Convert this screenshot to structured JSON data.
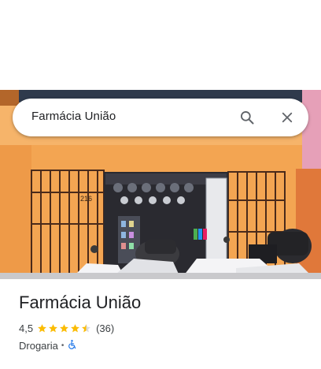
{
  "search": {
    "query": "Farmácia União"
  },
  "photo": {
    "shop_number": "216"
  },
  "place": {
    "title": "Farmácia União",
    "rating": "4,5",
    "rating_value": 4.5,
    "rating_max": 5,
    "review_count": "(36)",
    "category": "Drogaria",
    "separator": "•",
    "accessibility_icon": "wheelchair-icon"
  },
  "colors": {
    "star": "#fbbc04",
    "star_empty": "#dadce0",
    "accessibility_icon": "#1a73e8",
    "wall": "#f2a24e"
  }
}
